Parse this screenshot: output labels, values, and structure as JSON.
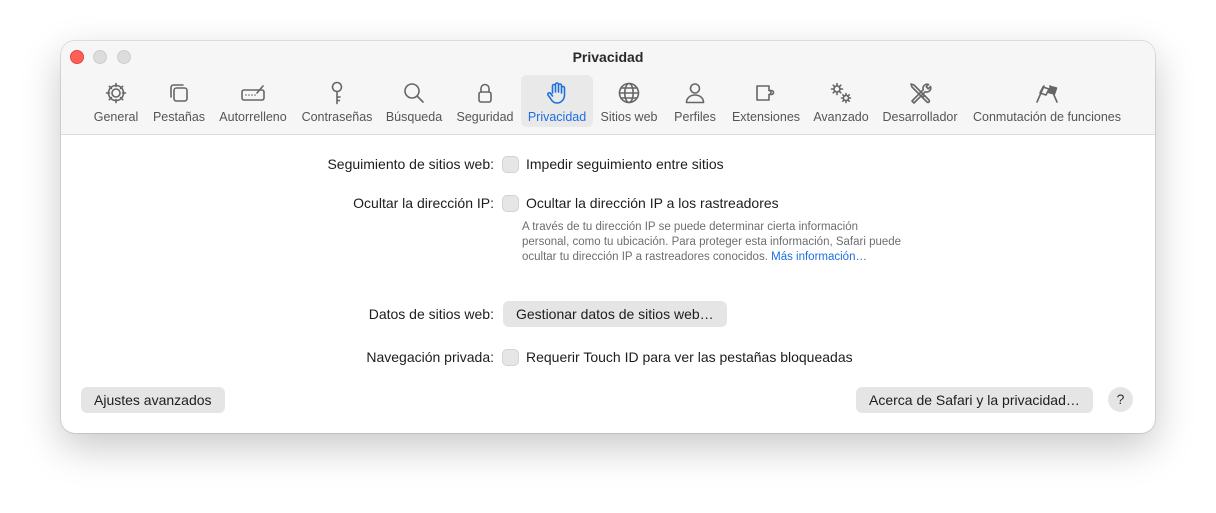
{
  "window": {
    "title": "Privacidad"
  },
  "toolbar": {
    "tabs": [
      {
        "label": "General",
        "icon": "gear-icon"
      },
      {
        "label": "Pestañas",
        "icon": "tabs-icon"
      },
      {
        "label": "Autorrelleno",
        "icon": "autofill-icon"
      },
      {
        "label": "Contraseñas",
        "icon": "key-icon"
      },
      {
        "label": "Búsqueda",
        "icon": "magnifier-icon"
      },
      {
        "label": "Seguridad",
        "icon": "lock-icon"
      },
      {
        "label": "Privacidad",
        "icon": "hand-icon",
        "selected": true
      },
      {
        "label": "Sitios web",
        "icon": "globe-icon"
      },
      {
        "label": "Perfiles",
        "icon": "person-icon"
      },
      {
        "label": "Extensiones",
        "icon": "puzzle-icon"
      },
      {
        "label": "Avanzado",
        "icon": "gears-icon"
      },
      {
        "label": "Desarrollador",
        "icon": "tools-icon"
      },
      {
        "label": "Conmutación de funciones",
        "icon": "flags-icon"
      }
    ]
  },
  "settings": {
    "tracking": {
      "label": "Seguimiento de sitios web:",
      "option": "Impedir seguimiento entre sitios",
      "checked": false
    },
    "hide_ip": {
      "label": "Ocultar la dirección IP:",
      "option": "Ocultar la dirección IP a los rastreadores",
      "checked": false,
      "description": "A través de tu dirección IP se puede determinar cierta información personal, como tu ubicación. Para proteger esta información, Safari puede ocultar tu dirección IP a rastreadores conocidos.",
      "link": "Más información…"
    },
    "website_data": {
      "label": "Datos de sitios web:",
      "button": "Gestionar datos de sitios web…"
    },
    "private_browsing": {
      "label": "Navegación privada:",
      "option": "Requerir Touch ID para ver las pestañas bloqueadas",
      "checked": false
    }
  },
  "footer": {
    "advanced_button": "Ajustes avanzados",
    "about_button": "Acerca de Safari y la privacidad…",
    "help_button": "?"
  },
  "colors": {
    "accent": "#1e6fe0",
    "close": "#fe5f57"
  }
}
